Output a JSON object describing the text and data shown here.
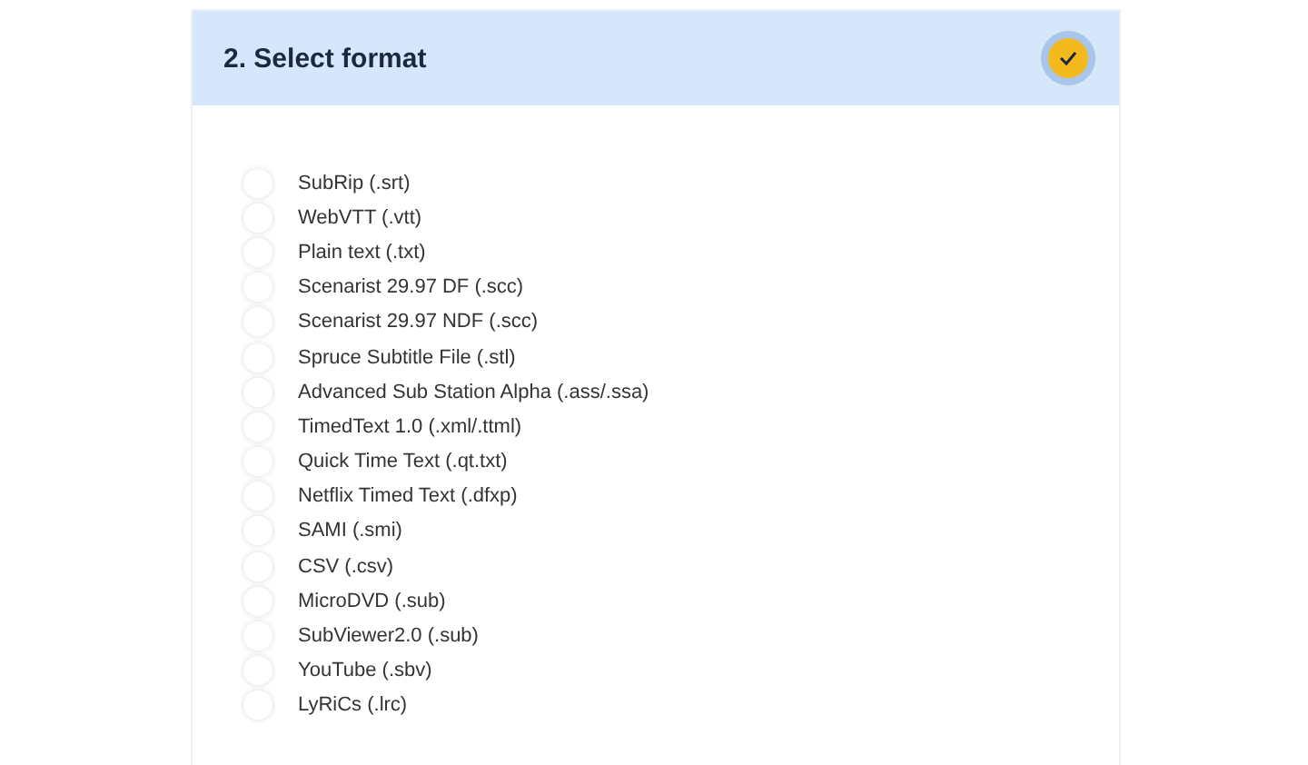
{
  "section": {
    "title": "2. Select format",
    "completed": true
  },
  "options": [
    {
      "label": "SubRip (.srt)",
      "selected": false
    },
    {
      "label": "WebVTT (.vtt)",
      "selected": false
    },
    {
      "label": "Plain text (.txt)",
      "selected": false
    },
    {
      "label": "Scenarist 29.97 DF (.scc)",
      "selected": false
    },
    {
      "label": "Scenarist 29.97 NDF (.scc)",
      "selected": false
    },
    {
      "label": "Spruce Subtitle File (.stl)",
      "selected": false
    },
    {
      "label": "Advanced Sub Station Alpha (.ass/.ssa)",
      "selected": false
    },
    {
      "label": "TimedText 1.0 (.xml/.ttml)",
      "selected": false
    },
    {
      "label": "Quick Time Text (.qt.txt)",
      "selected": false
    },
    {
      "label": "Netflix Timed Text (.dfxp)",
      "selected": false
    },
    {
      "label": "SAMI (.smi)",
      "selected": false
    },
    {
      "label": "CSV (.csv)",
      "selected": false
    },
    {
      "label": "MicroDVD (.sub)",
      "selected": false
    },
    {
      "label": "SubViewer2.0 (.sub)",
      "selected": false
    },
    {
      "label": "YouTube (.sbv)",
      "selected": false
    },
    {
      "label": "LyRiCs (.lrc)",
      "selected": false
    }
  ]
}
